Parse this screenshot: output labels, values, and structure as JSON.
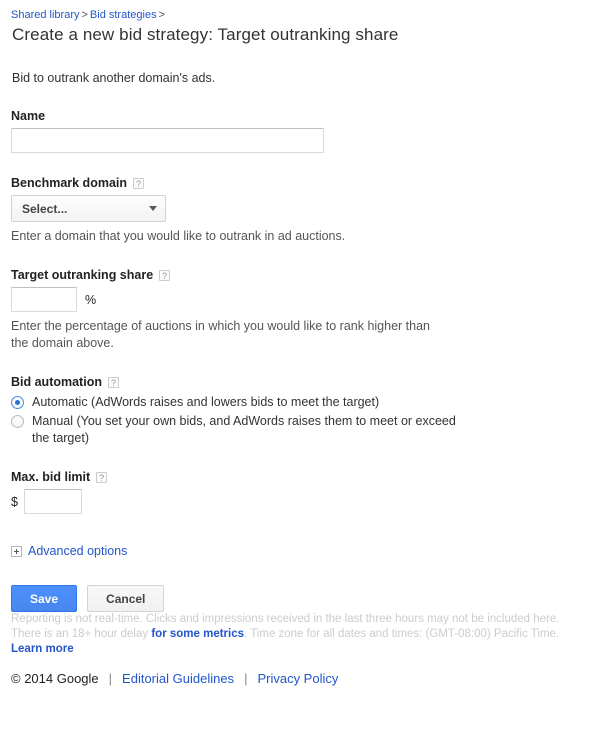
{
  "breadcrumb": {
    "items": [
      "Shared library",
      "Bid strategies"
    ],
    "separator": ">",
    "trailing": ">"
  },
  "header": {
    "title": "Create a new bid strategy: Target outranking share",
    "intro": "Bid to outrank another domain's ads."
  },
  "form": {
    "name": {
      "label": "Name",
      "value": "",
      "placeholder": ""
    },
    "benchmark_domain": {
      "label": "Benchmark domain",
      "help_icon": "?",
      "selected": "Select...",
      "options": [
        "Select..."
      ],
      "help_text": "Enter a domain that you would like to outrank in ad auctions."
    },
    "target_outranking_share": {
      "label": "Target outranking share",
      "help_icon": "?",
      "value": "",
      "unit": "%",
      "help_text": "Enter the percentage of auctions in which you would like to rank higher than the domain above."
    },
    "bid_automation": {
      "label": "Bid automation",
      "help_icon": "?",
      "options": [
        {
          "label": "Automatic (AdWords raises and lowers bids to meet the target)",
          "selected": true
        },
        {
          "label": "Manual (You set your own bids, and AdWords raises them to meet or exceed the target)",
          "selected": false
        }
      ]
    },
    "max_bid_limit": {
      "label": "Max. bid limit",
      "help_icon": "?",
      "currency": "$",
      "value": ""
    },
    "advanced_options": {
      "label": "Advanced options",
      "expander_icon": "plus-box-icon"
    }
  },
  "actions": {
    "save_label": "Save",
    "cancel_label": "Cancel"
  },
  "footer": {
    "disclaimer_line1": "Reporting is not real-time. Clicks and impressions received in the last three hours may not be included here.",
    "disclaimer_line2_part1": "There is an 18+ hour delay",
    "disclaimer_link1": "for some metrics",
    "disclaimer_line2_part2": ". Time zone for all dates and times: (GMT-08:00) Pacific Time.",
    "disclaimer_link2": "Learn more",
    "copyright": "© 2014 Google",
    "divider": "|",
    "link_editorial": "Editorial Guidelines",
    "link_privacy": "Privacy Policy"
  },
  "colors": {
    "link": "#2255cc",
    "primary_button": "#4d90fe",
    "radio_selected": "#2771d4",
    "disclaimer_text": "#cccccc"
  }
}
